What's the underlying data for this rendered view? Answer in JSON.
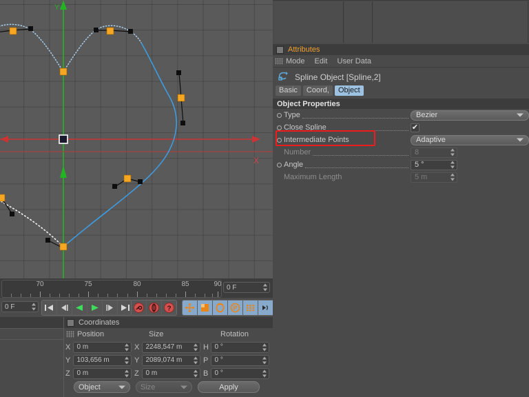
{
  "viewport": {
    "name": "perspective-viewport",
    "background_color": "#5a5a5a",
    "grid_color": "#4b4b4b",
    "axis_y_color": "#2ac02a",
    "axis_x_color": "#d03030",
    "spline_color": "#4fa3e3",
    "spline_unselected_color": "#a8cfee",
    "closing_segment_color": "#ffffff",
    "point_color": "#f0a030",
    "tangent_color": "#111111",
    "axis_x_label": "X",
    "axis_y_label": "Y"
  },
  "right_top_panel": {
    "cells": [
      "",
      "",
      ""
    ]
  },
  "attributes": {
    "title": "Attributes",
    "menu": [
      "Mode",
      "Edit",
      "User Data"
    ],
    "object_name": "Spline Object [Spline,2]",
    "object_icon": "spline-object-icon",
    "tabs": [
      {
        "label": "Basic",
        "active": false
      },
      {
        "label": "Coord,",
        "active": false
      },
      {
        "label": "Object",
        "active": true
      }
    ],
    "section_title": "Object Properties",
    "properties": [
      {
        "label": "Type",
        "widget": "combo",
        "value": "Bezier",
        "enabled": true,
        "dots": true
      },
      {
        "label": "Close Spline",
        "widget": "checkbox",
        "value": "✔",
        "enabled": true,
        "dots": true,
        "highlighted": true
      },
      {
        "label": "Intermediate Points",
        "widget": "combo",
        "value": "Adaptive",
        "enabled": true,
        "dots": false
      },
      {
        "label": "Number",
        "widget": "spin",
        "value": "8",
        "enabled": false,
        "dots": true
      },
      {
        "label": "Angle",
        "widget": "spin",
        "value": "5 °",
        "enabled": true,
        "dots": true
      },
      {
        "label": "Maximum Length",
        "widget": "spin",
        "value": "5 m",
        "enabled": false,
        "dots": false
      }
    ],
    "highlight_color": "#ef1c1c"
  },
  "timeline": {
    "tick_labels": [
      "70",
      "75",
      "80",
      "85",
      "90"
    ],
    "current_frame_right": "0 F",
    "current_frame_left": "0 F"
  },
  "toolbar": {
    "transport": [
      {
        "name": "go-to-start-icon",
        "glyph": "⏮"
      },
      {
        "name": "previous-key-icon",
        "glyph": "◀|"
      },
      {
        "name": "play-reverse-icon",
        "glyph": "◀"
      },
      {
        "name": "play-forward-icon",
        "glyph": "▶"
      },
      {
        "name": "next-key-icon",
        "glyph": "|▶"
      },
      {
        "name": "go-to-end-icon",
        "glyph": "⏭"
      }
    ],
    "record": [
      {
        "name": "record-active-objects-icon",
        "glyph": "key"
      },
      {
        "name": "autokeying-icon",
        "glyph": "ring"
      },
      {
        "name": "keyframe-selection-icon",
        "glyph": "?"
      }
    ],
    "modes": [
      {
        "name": "position-tool-icon",
        "glyph": "move"
      },
      {
        "name": "scale-tool-icon",
        "glyph": "scale"
      },
      {
        "name": "rotation-tool-icon",
        "glyph": "rot"
      },
      {
        "name": "parameter-tool-icon",
        "glyph": "P"
      },
      {
        "name": "point-level-icon",
        "glyph": "dots"
      },
      {
        "name": "pla-icon",
        "glyph": "pla"
      },
      {
        "name": "keyframe-doc-icon",
        "glyph": "doc"
      }
    ]
  },
  "coordinates": {
    "title": "Coordinates",
    "column_headers": [
      "Position",
      "Size",
      "Rotation"
    ],
    "rows": [
      {
        "pos_label": "X",
        "pos_value": "0 m",
        "size_label": "X",
        "size_value": "2248,547 m",
        "rot_label": "H",
        "rot_value": "0 °"
      },
      {
        "pos_label": "Y",
        "pos_value": "103,656 m",
        "size_label": "Y",
        "size_value": "2089,074 m",
        "rot_label": "P",
        "rot_value": "0 °"
      },
      {
        "pos_label": "Z",
        "pos_value": "0 m",
        "size_label": "Z",
        "size_value": "0 m",
        "rot_label": "B",
        "rot_value": "0 °"
      }
    ],
    "mode_dropdown": "Object",
    "size_dropdown": "Size",
    "apply_button": "Apply"
  }
}
